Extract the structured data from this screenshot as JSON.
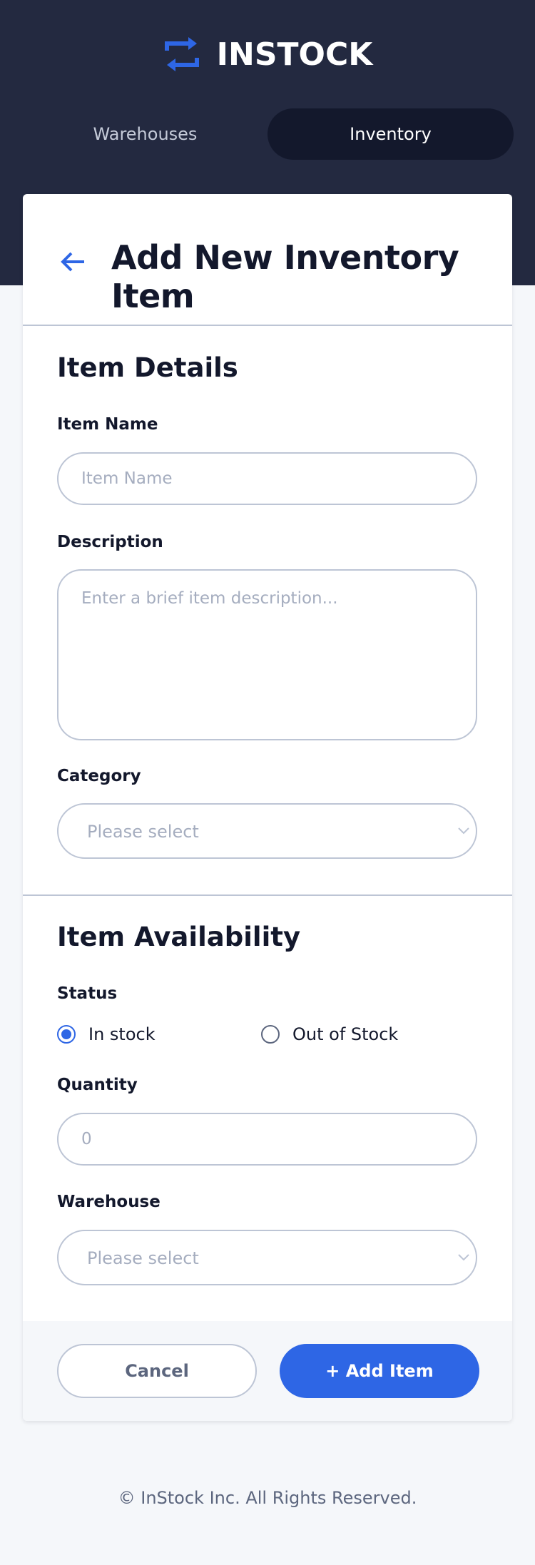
{
  "brand": {
    "name": "INSTOCK",
    "accent": "#2E66E5",
    "header_bg": "#232940"
  },
  "nav": {
    "tabs": [
      {
        "label": "Warehouses",
        "active": false
      },
      {
        "label": "Inventory",
        "active": true
      }
    ]
  },
  "page": {
    "title": "Add New Inventory Item",
    "back_icon": "arrow-back-icon"
  },
  "item_details": {
    "title": "Item Details",
    "item_name_label": "Item Name",
    "item_name_placeholder": "Item Name",
    "item_name_value": "",
    "description_label": "Description",
    "description_placeholder": "Enter a brief item description...",
    "description_value": "",
    "category_label": "Category",
    "category_value": "Please select"
  },
  "item_availability": {
    "title": "Item Availability",
    "status_label": "Status",
    "status_options": [
      {
        "label": "In stock",
        "checked": true
      },
      {
        "label": "Out of Stock",
        "checked": false
      }
    ],
    "quantity_label": "Quantity",
    "quantity_placeholder": "0",
    "quantity_value": "",
    "warehouse_label": "Warehouse",
    "warehouse_value": "Please select"
  },
  "actions": {
    "cancel_label": "Cancel",
    "add_label": "+ Add Item"
  },
  "footer": {
    "copyright": "© InStock Inc. All Rights Reserved."
  }
}
